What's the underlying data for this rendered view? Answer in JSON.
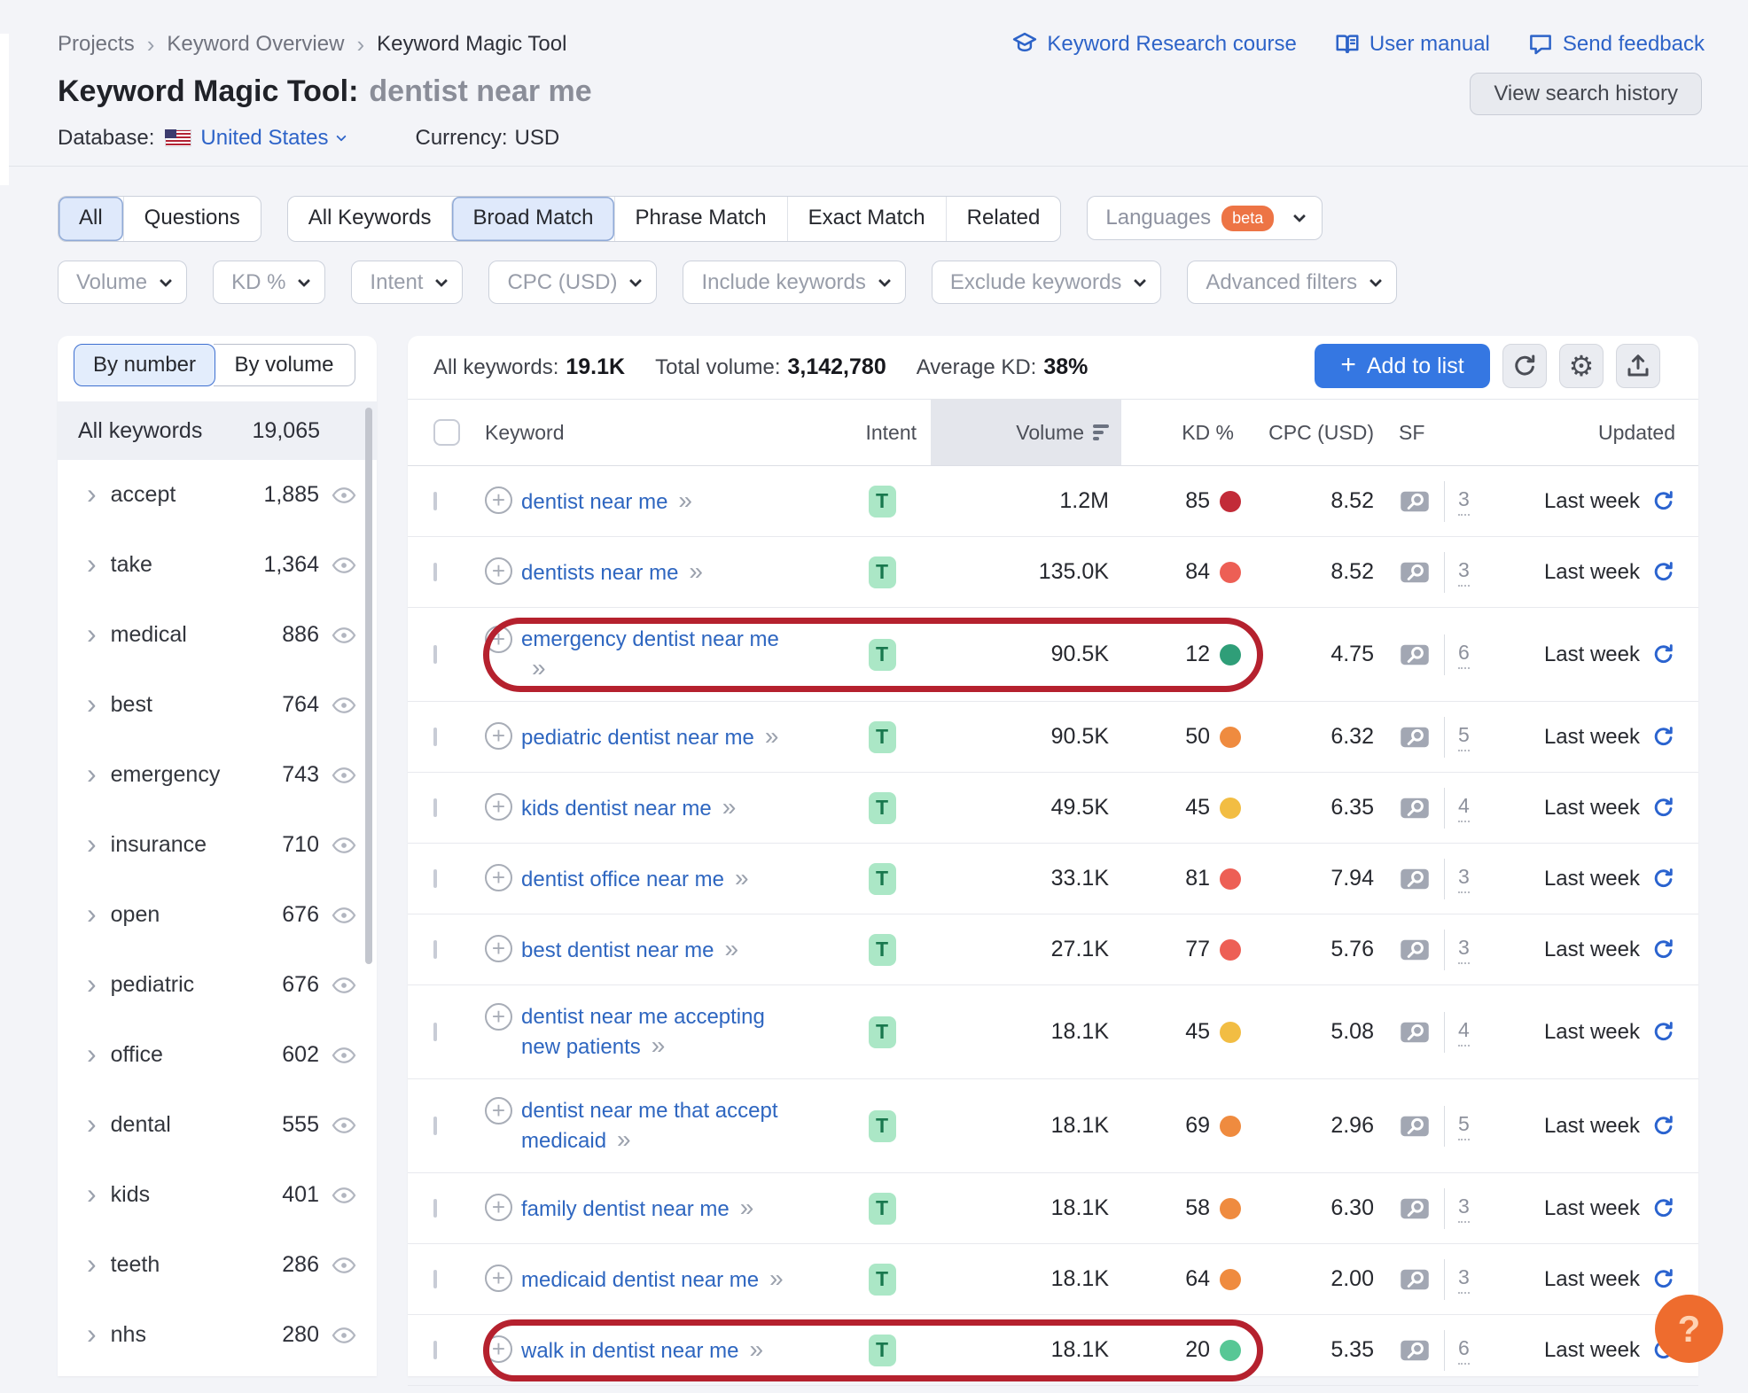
{
  "breadcrumb": {
    "items": [
      "Projects",
      "Keyword Overview",
      "Keyword Magic Tool"
    ],
    "separator": "›"
  },
  "header": {
    "title": "Keyword Magic Tool:",
    "query": "dentist near me",
    "database_label": "Database:",
    "database_value": "United States",
    "currency_label": "Currency:",
    "currency_value": "USD",
    "links": [
      {
        "icon": "graduation-cap-icon",
        "label": "Keyword Research course"
      },
      {
        "icon": "book-icon",
        "label": "User manual"
      },
      {
        "icon": "speech-bubble-icon",
        "label": "Send feedback"
      }
    ],
    "view_history_label": "View search history"
  },
  "filters": {
    "tab_group_1": [
      {
        "label": "All",
        "selected": true
      },
      {
        "label": "Questions",
        "selected": false
      }
    ],
    "tab_group_2": [
      {
        "label": "All Keywords",
        "selected": false
      },
      {
        "label": "Broad Match",
        "selected": true
      },
      {
        "label": "Phrase Match",
        "selected": false
      },
      {
        "label": "Exact Match",
        "selected": false
      },
      {
        "label": "Related",
        "selected": false
      }
    ],
    "languages": {
      "label": "Languages",
      "badge": "beta"
    },
    "dropdowns": [
      "Volume",
      "KD %",
      "Intent",
      "CPC (USD)",
      "Include keywords",
      "Exclude keywords",
      "Advanced filters"
    ]
  },
  "sidebar": {
    "toggle": {
      "by_number": "By number",
      "by_volume": "By volume",
      "selected": "By number"
    },
    "all_keywords_label": "All keywords",
    "all_keywords_count": "19,065",
    "groups": [
      {
        "label": "accept",
        "count": "1,885"
      },
      {
        "label": "take",
        "count": "1,364"
      },
      {
        "label": "medical",
        "count": "886"
      },
      {
        "label": "best",
        "count": "764"
      },
      {
        "label": "emergency",
        "count": "743"
      },
      {
        "label": "insurance",
        "count": "710"
      },
      {
        "label": "open",
        "count": "676"
      },
      {
        "label": "pediatric",
        "count": "676"
      },
      {
        "label": "office",
        "count": "602"
      },
      {
        "label": "dental",
        "count": "555"
      },
      {
        "label": "kids",
        "count": "401"
      },
      {
        "label": "teeth",
        "count": "286"
      },
      {
        "label": "nhs",
        "count": "280"
      }
    ]
  },
  "table": {
    "summary": {
      "all_keywords_label": "All keywords:",
      "all_keywords_value": "19.1K",
      "total_volume_label": "Total volume:",
      "total_volume_value": "3,142,780",
      "avg_kd_label": "Average KD:",
      "avg_kd_value": "38%"
    },
    "add_to_list_label": "Add to list",
    "sorted_column": "Volume",
    "columns": {
      "keyword": "Keyword",
      "intent": "Intent",
      "volume": "Volume",
      "kd": "KD %",
      "cpc": "CPC (USD)",
      "sf": "SF",
      "updated": "Updated"
    },
    "rows": [
      {
        "keyword_lines": [
          "dentist near me"
        ],
        "arrow_newline": false,
        "intent": "T",
        "volume": "1.2M",
        "kd": "85",
        "kd_color": "#c22b38",
        "cpc": "8.52",
        "sf": "3",
        "updated": "Last week",
        "annotated": false
      },
      {
        "keyword_lines": [
          "dentists near me"
        ],
        "arrow_newline": false,
        "intent": "T",
        "volume": "135.0K",
        "kd": "84",
        "kd_color": "#ed5f55",
        "cpc": "8.52",
        "sf": "3",
        "updated": "Last week",
        "annotated": false
      },
      {
        "keyword_lines": [
          "emergency dentist near me"
        ],
        "arrow_newline": true,
        "intent": "T",
        "volume": "90.5K",
        "kd": "12",
        "kd_color": "#2f9e78",
        "cpc": "4.75",
        "sf": "6",
        "updated": "Last week",
        "annotated": true
      },
      {
        "keyword_lines": [
          "pediatric dentist near me"
        ],
        "arrow_newline": false,
        "intent": "T",
        "volume": "90.5K",
        "kd": "50",
        "kd_color": "#ef8b3f",
        "cpc": "6.32",
        "sf": "5",
        "updated": "Last week",
        "annotated": false
      },
      {
        "keyword_lines": [
          "kids dentist near me"
        ],
        "arrow_newline": false,
        "intent": "T",
        "volume": "49.5K",
        "kd": "45",
        "kd_color": "#f2bd43",
        "cpc": "6.35",
        "sf": "4",
        "updated": "Last week",
        "annotated": false
      },
      {
        "keyword_lines": [
          "dentist office near me"
        ],
        "arrow_newline": false,
        "intent": "T",
        "volume": "33.1K",
        "kd": "81",
        "kd_color": "#ed5f55",
        "cpc": "7.94",
        "sf": "3",
        "updated": "Last week",
        "annotated": false
      },
      {
        "keyword_lines": [
          "best dentist near me"
        ],
        "arrow_newline": false,
        "intent": "T",
        "volume": "27.1K",
        "kd": "77",
        "kd_color": "#ed5f55",
        "cpc": "5.76",
        "sf": "3",
        "updated": "Last week",
        "annotated": false
      },
      {
        "keyword_lines": [
          "dentist near me accepting",
          "new patients"
        ],
        "arrow_newline": false,
        "intent": "T",
        "volume": "18.1K",
        "kd": "45",
        "kd_color": "#f2bd43",
        "cpc": "5.08",
        "sf": "4",
        "updated": "Last week",
        "annotated": false
      },
      {
        "keyword_lines": [
          "dentist near me that accept",
          "medicaid"
        ],
        "arrow_newline": false,
        "intent": "T",
        "volume": "18.1K",
        "kd": "69",
        "kd_color": "#ef8b3f",
        "cpc": "2.96",
        "sf": "5",
        "updated": "Last week",
        "annotated": false
      },
      {
        "keyword_lines": [
          "family dentist near me"
        ],
        "arrow_newline": false,
        "intent": "T",
        "volume": "18.1K",
        "kd": "58",
        "kd_color": "#ef8b3f",
        "cpc": "6.30",
        "sf": "3",
        "updated": "Last week",
        "annotated": false
      },
      {
        "keyword_lines": [
          "medicaid dentist near me"
        ],
        "arrow_newline": false,
        "intent": "T",
        "volume": "18.1K",
        "kd": "64",
        "kd_color": "#ef8b3f",
        "cpc": "2.00",
        "sf": "3",
        "updated": "Last week",
        "annotated": false
      },
      {
        "keyword_lines": [
          "walk in dentist near me"
        ],
        "arrow_newline": false,
        "intent": "T",
        "volume": "18.1K",
        "kd": "20",
        "kd_color": "#57c795",
        "cpc": "5.35",
        "sf": "6",
        "updated": "Last week",
        "annotated": true
      }
    ]
  },
  "help_button": {
    "label": "?"
  },
  "colors": {
    "accent_blue": "#3577e2",
    "link_blue": "#2d63c8",
    "keyword_link": "#2e66c0",
    "annotation_red": "#b5212e",
    "beta_orange": "#ed7445",
    "help_orange": "#ee6c2e",
    "intent_badge_bg": "#abe7c6",
    "intent_badge_fg": "#19784e"
  }
}
